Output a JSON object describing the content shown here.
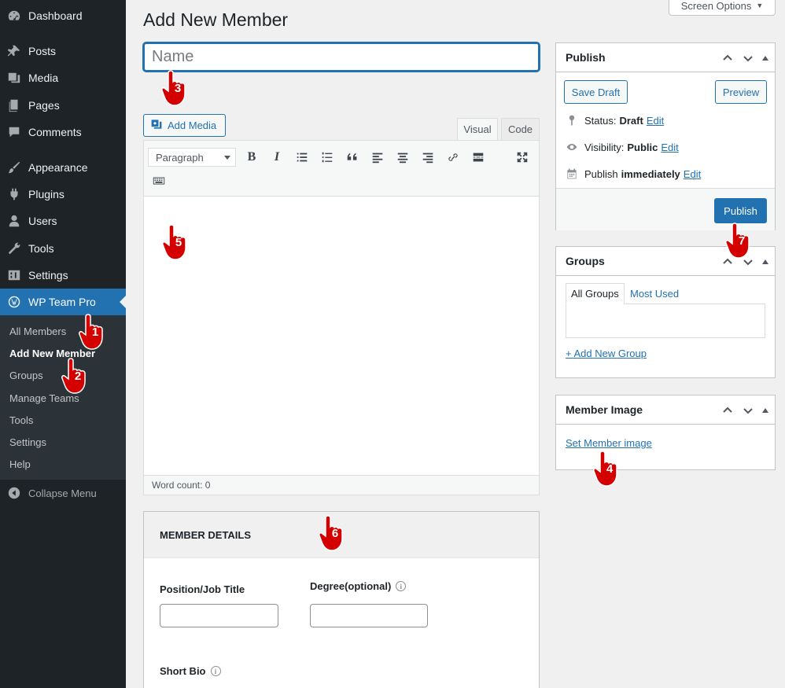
{
  "sidebar": {
    "items": [
      {
        "label": "Dashboard",
        "icon": "dashboard-icon"
      },
      {
        "label": "Posts",
        "icon": "pin-icon"
      },
      {
        "label": "Media",
        "icon": "media-icon"
      },
      {
        "label": "Pages",
        "icon": "pages-icon"
      },
      {
        "label": "Comments",
        "icon": "comment-icon"
      },
      {
        "label": "Appearance",
        "icon": "brush-icon"
      },
      {
        "label": "Plugins",
        "icon": "plugin-icon"
      },
      {
        "label": "Users",
        "icon": "user-icon"
      },
      {
        "label": "Tools",
        "icon": "wrench-icon"
      },
      {
        "label": "Settings",
        "icon": "settings-icon"
      },
      {
        "label": "WP Team Pro",
        "icon": "wordpress-icon"
      }
    ],
    "submenu": [
      "All Members",
      "Add New Member",
      "Groups",
      "Manage Teams",
      "Tools",
      "Settings",
      "Help"
    ],
    "collapse": "Collapse Menu"
  },
  "screen_options": "Screen Options",
  "page_title": "Add New Member",
  "title_placeholder": "Name",
  "editor": {
    "add_media": "Add Media",
    "tab_visual": "Visual",
    "tab_code": "Code",
    "format": "Paragraph",
    "word_count": "Word count: 0"
  },
  "member_details": {
    "heading": "MEMBER DETAILS",
    "position_label": "Position/Job Title",
    "degree_label": "Degree(optional)",
    "bio_label": "Short Bio"
  },
  "publish": {
    "title": "Publish",
    "save_draft": "Save Draft",
    "preview": "Preview",
    "status_label": "Status:",
    "status_value": "Draft",
    "visibility_label": "Visibility:",
    "visibility_value": "Public",
    "publish_label": "Publish",
    "publish_value": "immediately",
    "edit": "Edit",
    "publish_button": "Publish"
  },
  "groups": {
    "title": "Groups",
    "tab_all": "All Groups",
    "tab_used": "Most Used",
    "add_new": "+ Add New Group"
  },
  "member_image": {
    "title": "Member Image",
    "set_link": "Set Member image"
  },
  "annotations": [
    "1",
    "2",
    "3",
    "4",
    "5",
    "6",
    "7"
  ],
  "colors": {
    "accent": "#2271b1",
    "sidebar": "#1d2327",
    "annotation": "#d40000"
  }
}
